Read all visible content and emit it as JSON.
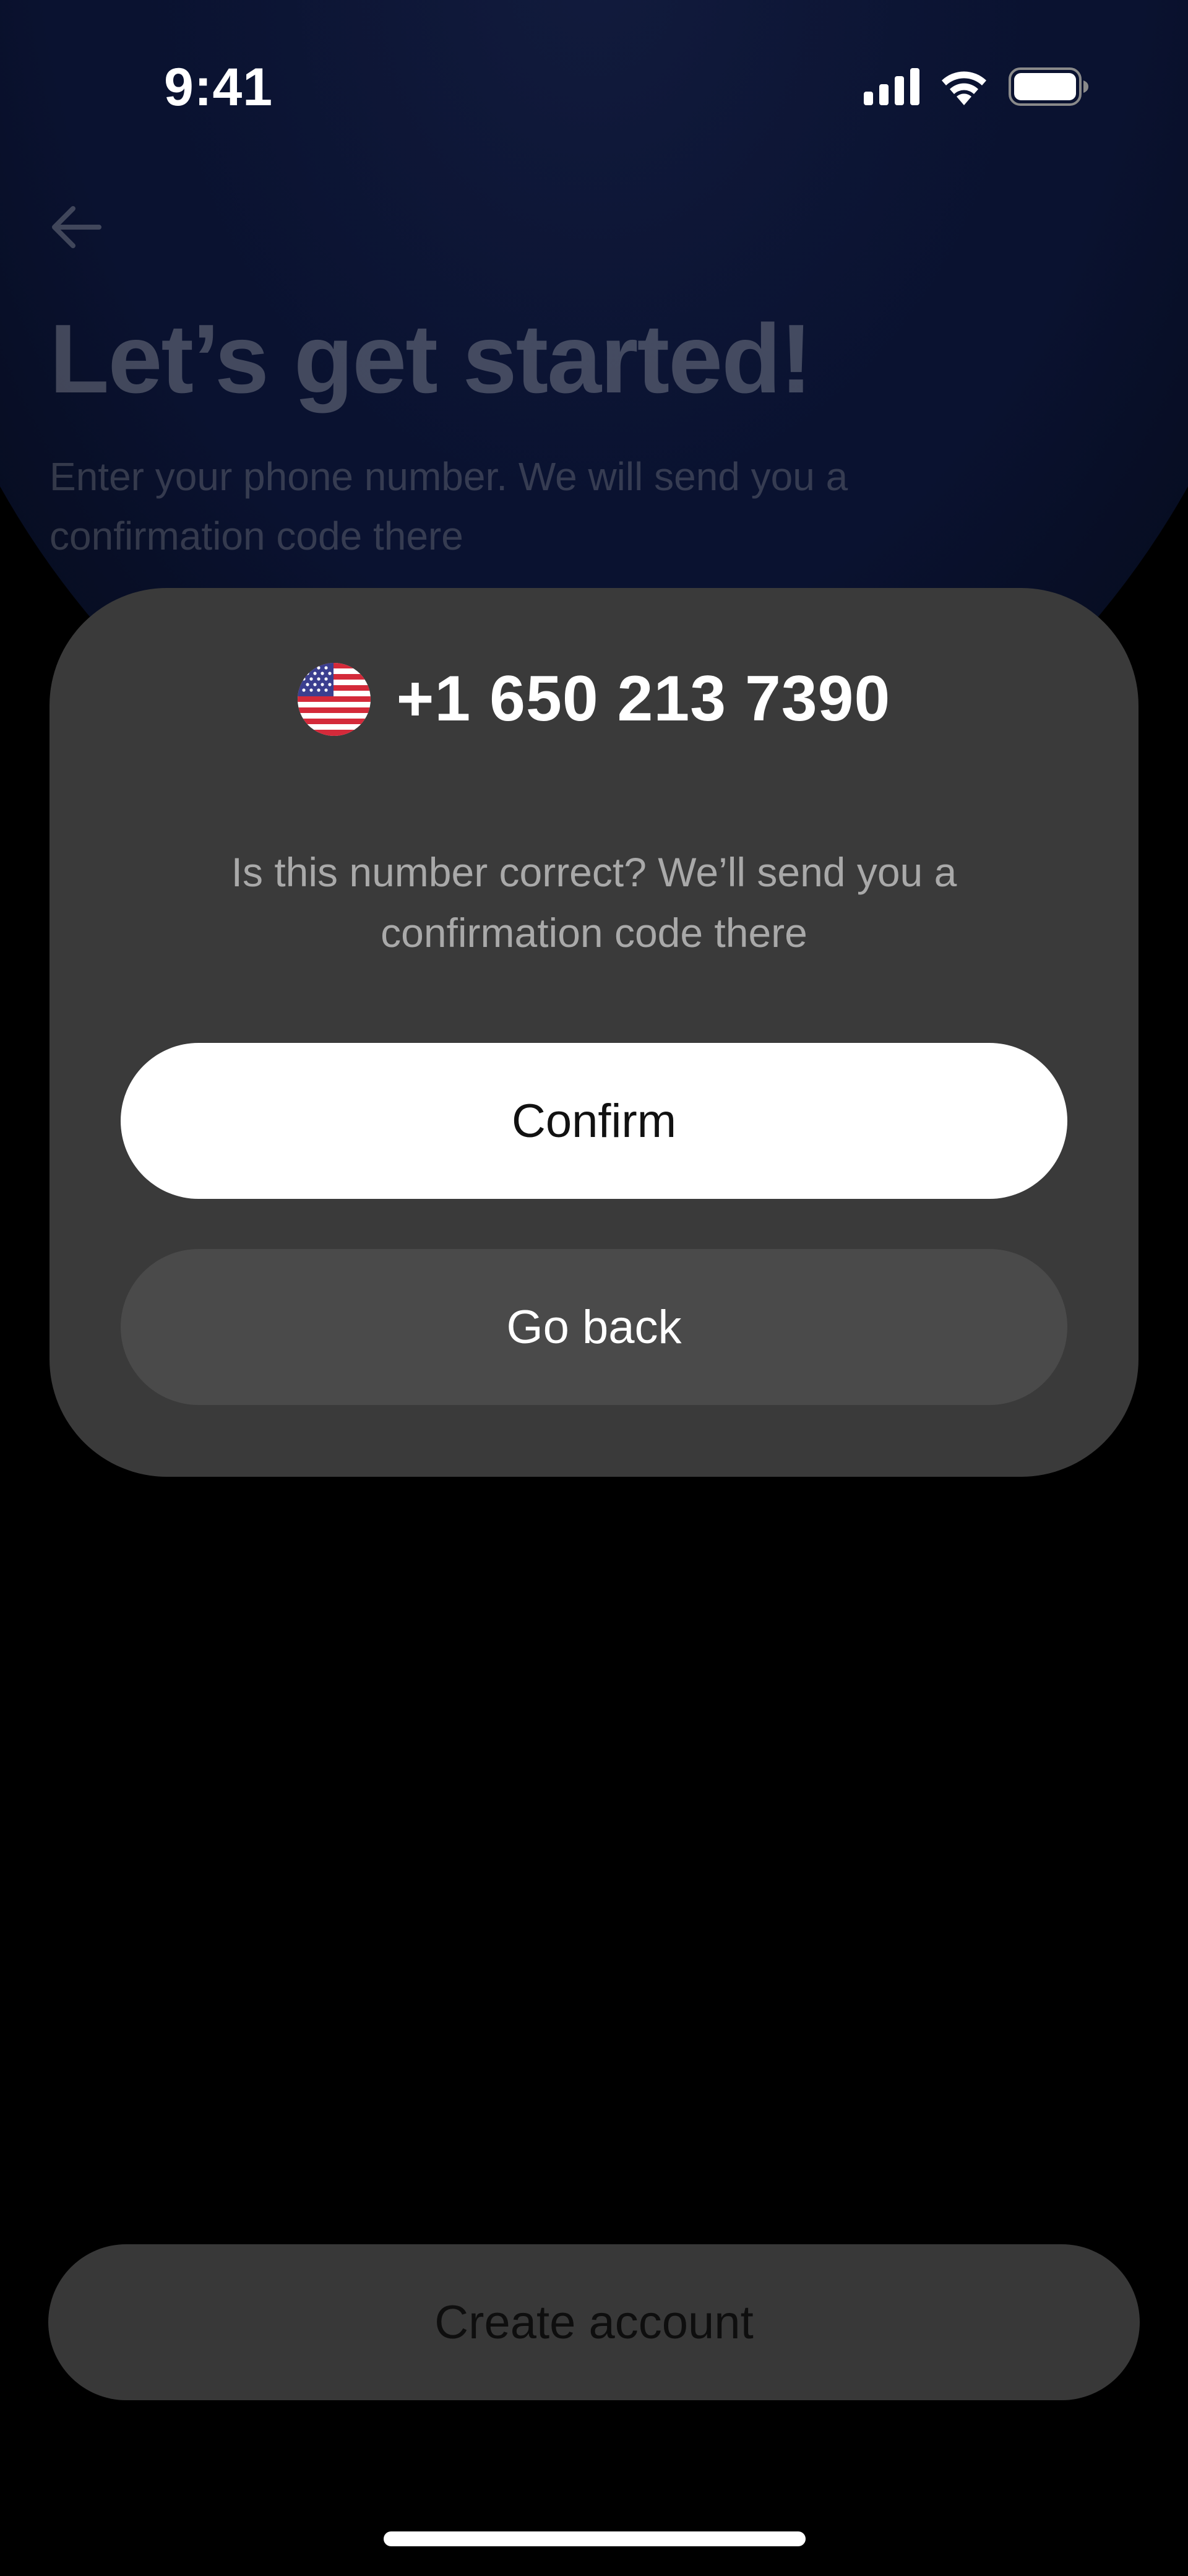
{
  "status_bar": {
    "time": "9:41",
    "icons": [
      "cellular-signal-icon",
      "wifi-icon",
      "battery-icon"
    ]
  },
  "page": {
    "back_icon": "arrow-left-icon",
    "title": "Let’s get started!",
    "subtitle": "Enter your phone number. We will send you a confirmation code there"
  },
  "dialog": {
    "flag_icon": "us-flag-icon",
    "phone_number": "+1 650 213 7390",
    "message": "Is this number correct? We’ll send you a confirmation code there",
    "confirm_label": "Confirm",
    "go_back_label": "Go back"
  },
  "footer": {
    "create_account_label": "Create account"
  },
  "colors": {
    "background": "#000000",
    "navy_glow": "#0a1230",
    "dialog_bg": "#3a3a3a",
    "confirm_bg": "#ffffff",
    "go_back_bg": "#4a4a4a",
    "create_account_bg": "#383838"
  }
}
